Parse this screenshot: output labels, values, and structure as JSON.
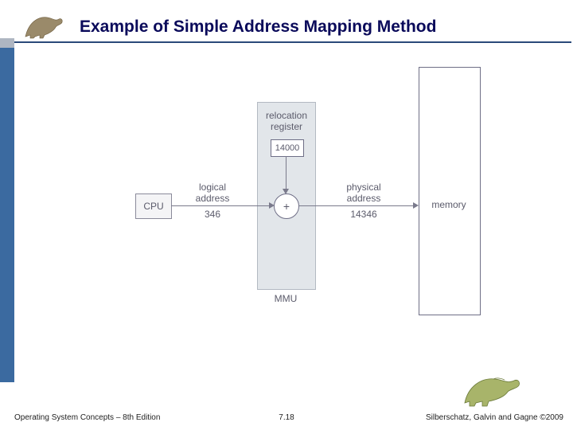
{
  "header": {
    "title": "Example of Simple Address Mapping Method"
  },
  "footer": {
    "left": "Operating System Concepts – 8th Edition",
    "center": "7.18",
    "right": "Silberschatz, Galvin and Gagne ©2009"
  },
  "diagram": {
    "cpu": "CPU",
    "logical_label_a": "logical",
    "logical_label_b": "address",
    "logical_value": "346",
    "relocation_label_a": "relocation",
    "relocation_label_b": "register",
    "relocation_value": "14000",
    "plus": "+",
    "physical_label_a": "physical",
    "physical_label_b": "address",
    "physical_value": "14346",
    "memory": "memory",
    "mmu": "MMU"
  }
}
